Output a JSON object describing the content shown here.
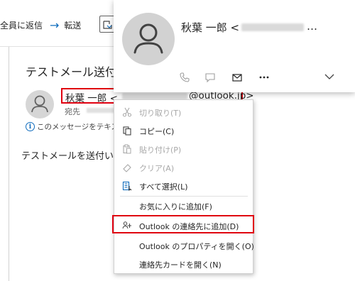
{
  "toolbar": {
    "reply_all_label": "全員に返信",
    "forward_label": "転送",
    "forward_icon": "arrow-right-icon"
  },
  "mail": {
    "subject": "テストメール送付の",
    "sender_name": "秋葉 一郎 <",
    "sender_domain": "@outlook.jp>",
    "to_label": "宛先",
    "info_text": "このメッセージをテキスト形",
    "body_text": "テストメールを送付い"
  },
  "contact_card": {
    "name_prefix": "秋葉 一郎 <",
    "name_suffix": "…",
    "actions": [
      "phone-icon",
      "chat-icon",
      "mail-icon",
      "more-icon"
    ],
    "expand_icon": "chevron-down-icon"
  },
  "context_menu": {
    "items": [
      {
        "label": "切り取り(T)",
        "icon": "scissors-icon",
        "enabled": false
      },
      {
        "label": "コピー(C)",
        "icon": "copy-icon",
        "enabled": true
      },
      {
        "label": "貼り付け(P)",
        "icon": "paste-icon",
        "enabled": false
      },
      {
        "label": "クリア(A)",
        "icon": "eraser-icon",
        "enabled": false
      },
      {
        "label": "すべて選択(L)",
        "icon": "select-all-icon",
        "enabled": true
      },
      {
        "label": "お気に入りに追加(F)",
        "icon": "",
        "enabled": true
      },
      {
        "label": "Outlook の連絡先に追加(D)",
        "icon": "add-contact-icon",
        "enabled": true
      },
      {
        "label": "Outlook のプロパティを開く(O)",
        "icon": "",
        "enabled": true
      },
      {
        "label": "連絡先カードを開く(N)",
        "icon": "",
        "enabled": true
      }
    ],
    "highlighted_item": "Outlook の連絡先に追加(D)"
  },
  "colors": {
    "accent": "#0f6cbd",
    "highlight_border": "#e00010",
    "disabled_text": "#a8a8a8"
  }
}
